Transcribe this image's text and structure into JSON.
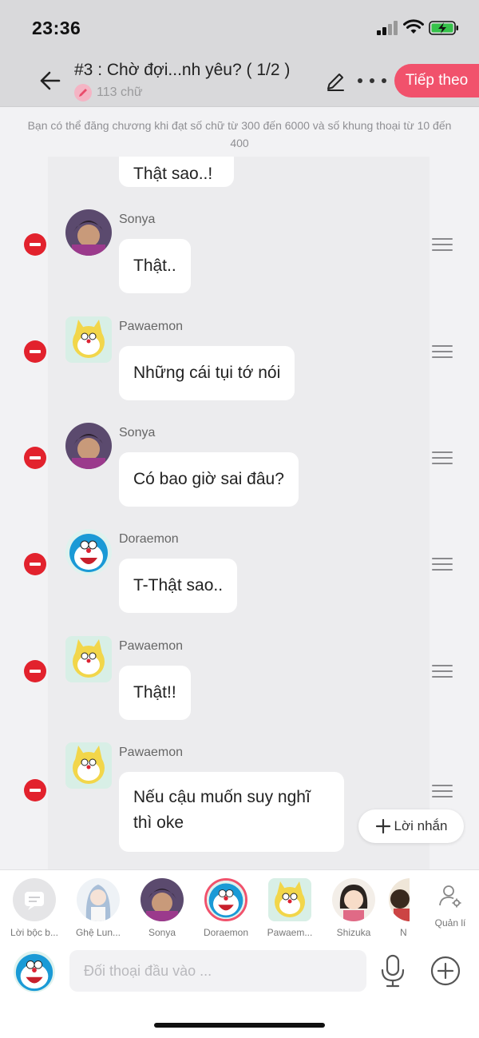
{
  "status_bar": {
    "time": "23:36"
  },
  "header": {
    "title": "#3 : Chờ đợi...nh yêu? ( 1/2 )",
    "word_count": "113 chữ",
    "next_label": "Tiếp theo"
  },
  "notice": "Bạn có thể đăng chương khi đạt số chữ từ 300 đến 6000 và số khung thoại từ 10 đến 400",
  "messages": {
    "partial_text": "Thật sao..!",
    "items": [
      {
        "name": "Sonya",
        "text": "Thật.."
      },
      {
        "name": "Pawaemon",
        "text": "Những cái tụi tớ nói"
      },
      {
        "name": "Sonya",
        "text": "Có bao giờ sai đâu?"
      },
      {
        "name": "Doraemon",
        "text": "T-Thật sao.."
      },
      {
        "name": "Pawaemon",
        "text": "Thật!!"
      },
      {
        "name": "Pawaemon",
        "text": "Nếu cậu muốn suy nghĩ thì oke"
      }
    ]
  },
  "note_button": "Lời nhắn",
  "characters": [
    {
      "label": "Lời bộc b..."
    },
    {
      "label": "Ghệ Lun..."
    },
    {
      "label": "Sonya"
    },
    {
      "label": "Doraemon"
    },
    {
      "label": "Pawaem..."
    },
    {
      "label": "Shizuka"
    },
    {
      "label": "N"
    }
  ],
  "manage_label": "Quản lí",
  "input": {
    "placeholder": "Đối thoại đầu vào ..."
  },
  "colors": {
    "accent": "#f1526c",
    "delete": "#e2222d",
    "header_bg": "#d9d9db"
  }
}
